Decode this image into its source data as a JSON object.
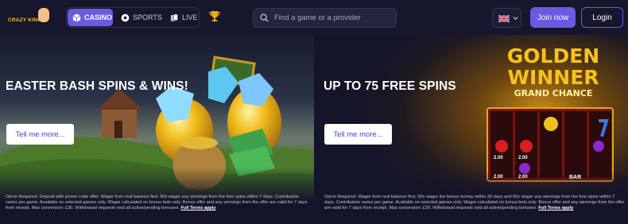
{
  "header": {
    "logo_text": "CRAZY KING",
    "nav": {
      "casino": "CASINO",
      "sports": "SPORTS",
      "live": "LIVE"
    },
    "search_placeholder": "Find a game or a provider",
    "join_label": "Join now",
    "login_label": "Login"
  },
  "promos": [
    {
      "title": "EASTER BASH SPINS & WINS!",
      "button": "Tell me more...",
      "terms": "Opt-in Required. Deposit with promo code offer. Wager from real balance first. 50x wager any winnings from the free spins within 7 days. Contribution varies per game. Available on selected games only. Wager calculated on bonus bets only. Bonus offer and any winnings from the offer are valid for 7 days from receipt. Max conversion: £30. Withdrawal requests void all active/pending bonuses.",
      "terms_link": "Full Terms apply"
    },
    {
      "title": "UP TO 75 FREE SPINS",
      "button": "Tell me more...",
      "terms": "Opt-in Required. Wager from real balance first. 50x wager the bonus money within 30 days and 50x wager any winnings from the free spins within 7 days. Contribution varies per game. Available on selected games only. Wager calculated on bonus bets only. Bonus offer and any winnings from the offer are valid for 7 days from receipt. Max conversion: £20. Withdrawal requests void all active/pending bonuses.",
      "terms_link": "Full Terms apply",
      "game_art": {
        "line1": "GOLDEN",
        "line2": "WINNER",
        "line3": "GRAND CHANCE",
        "tags": [
          "2.00",
          "2.00",
          "2.00",
          "2.00",
          "BAR"
        ]
      }
    }
  ],
  "colors": {
    "background": "#14142a",
    "accent": "#6a5ae0",
    "gold": "#f5c22b"
  },
  "icons": [
    "logo",
    "casino-cube-icon",
    "sports-ball-icon",
    "live-cards-icon",
    "trophy-icon",
    "search-icon",
    "uk-flag-icon",
    "chevron-down-icon"
  ]
}
